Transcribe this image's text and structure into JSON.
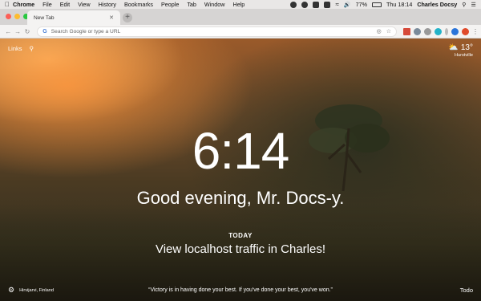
{
  "menubar": {
    "app_name": "Chrome",
    "items": [
      "File",
      "Edit",
      "View",
      "History",
      "Bookmarks",
      "People",
      "Tab",
      "Window",
      "Help"
    ],
    "battery": "77%",
    "clock": "Thu 18:14",
    "user": "Charles Docsy"
  },
  "tabs": [
    {
      "title": "New Tab"
    }
  ],
  "omnibox": {
    "placeholder": "Search Google or type a URL"
  },
  "page": {
    "links_label": "Links",
    "weather": {
      "temp": "13°",
      "location": "Hurstville"
    },
    "time": "6:14",
    "greeting": "Good evening, Mr. Docs-y.",
    "today_label": "TODAY",
    "focus_text": "View localhost traffic in Charles!",
    "photo_location": "Hirvijarvi, Finland",
    "quote": "“Victory is in having done your best. If you've done your best, you've won.”",
    "todo_label": "Todo"
  },
  "colors": {
    "menubar": "#e9e7e6",
    "tabstrip": "#d6d4d3",
    "toolbar": "#f4f3f2",
    "accent": "#4a7fd6"
  }
}
